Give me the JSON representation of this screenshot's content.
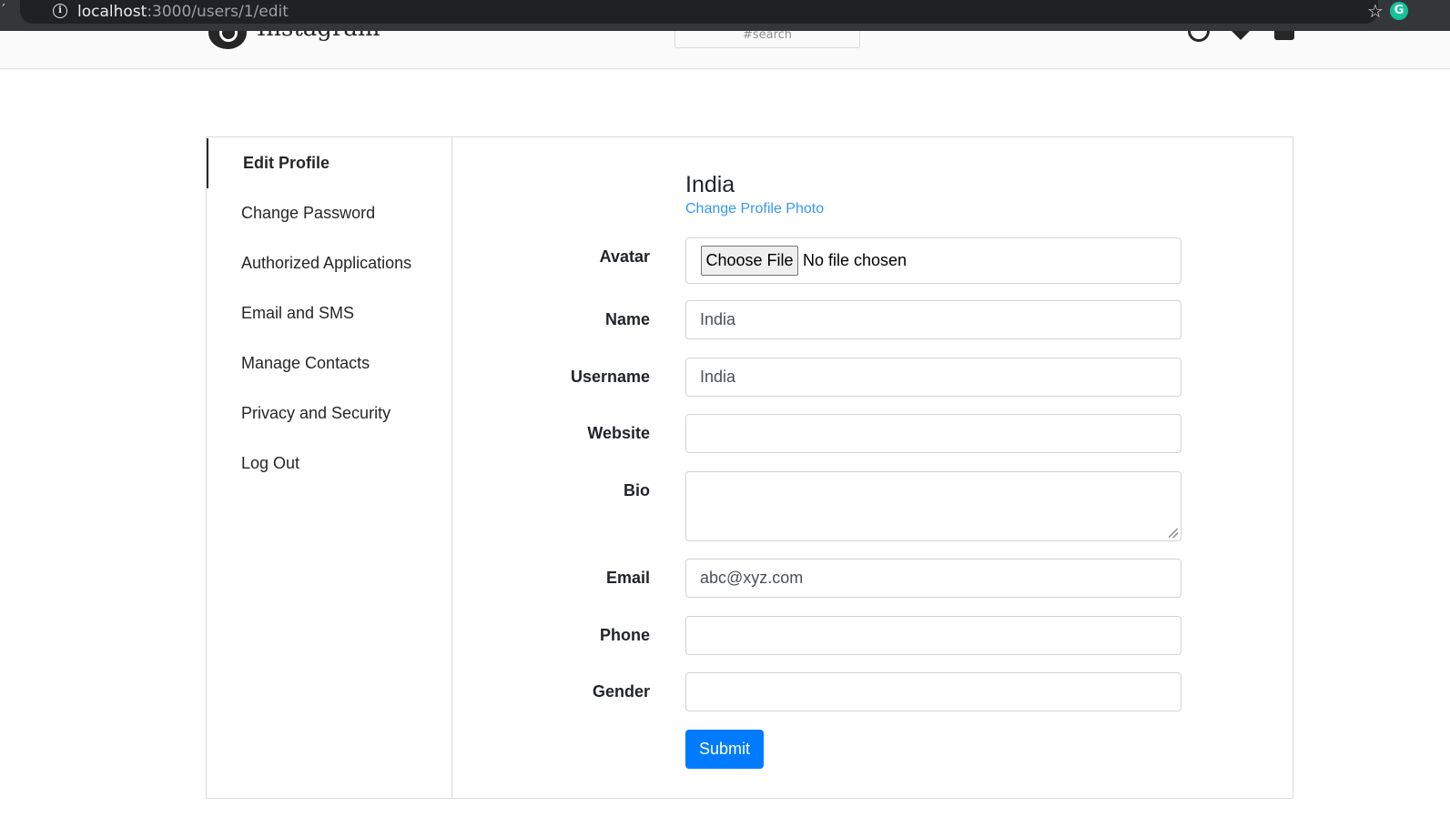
{
  "browser": {
    "url_host": "localhost",
    "url_path": ":3000/users/1/edit",
    "edge_glyph": "´",
    "info_icon": "i",
    "star_icon": "☆",
    "extension_icon": "G"
  },
  "navbar": {
    "brand": "Instagram",
    "search_placeholder": "#search"
  },
  "sidebar": {
    "items": [
      {
        "label": "Edit Profile",
        "active": true
      },
      {
        "label": "Change Password"
      },
      {
        "label": "Authorized Applications"
      },
      {
        "label": "Email and SMS"
      },
      {
        "label": "Manage Contacts"
      },
      {
        "label": "Privacy and Security"
      },
      {
        "label": "Log Out"
      }
    ]
  },
  "profile": {
    "name": "India",
    "change_photo_link": "Change Profile Photo"
  },
  "form": {
    "avatar": {
      "label": "Avatar",
      "button": "Choose File",
      "status": "No file chosen"
    },
    "name": {
      "label": "Name",
      "value": "India"
    },
    "username": {
      "label": "Username",
      "value": "India"
    },
    "website": {
      "label": "Website",
      "value": ""
    },
    "bio": {
      "label": "Bio",
      "value": ""
    },
    "email": {
      "label": "Email",
      "value": "abc@xyz.com"
    },
    "phone": {
      "label": "Phone",
      "value": ""
    },
    "gender": {
      "label": "Gender",
      "value": ""
    },
    "submit_label": "Submit"
  },
  "colors": {
    "primary_button": "#007bff",
    "link": "#3897f0",
    "border": "#dbdbdb"
  }
}
